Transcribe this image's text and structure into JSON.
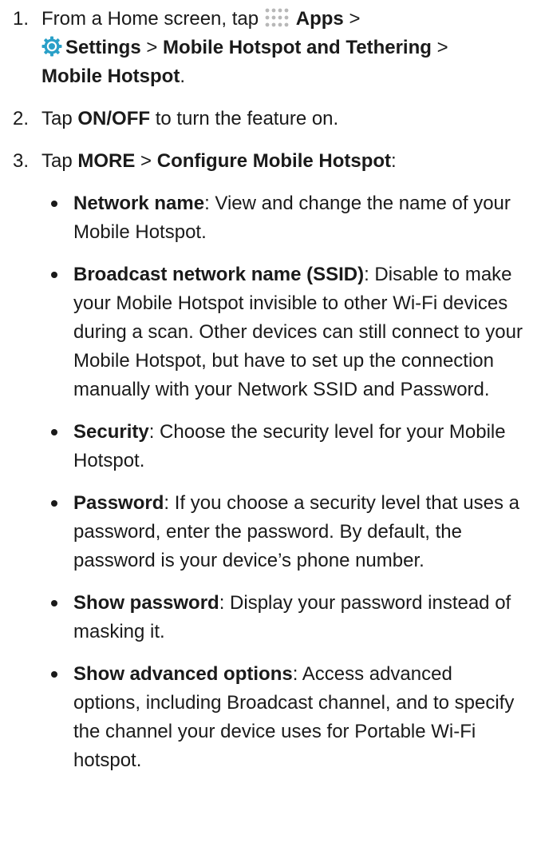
{
  "steps": [
    {
      "number": "1.",
      "parts": {
        "intro": "From a Home screen, tap",
        "apps": "Apps",
        "sep1": ">",
        "settings": "Settings",
        "sep2": ">",
        "hotspot_tethering": "Mobile Hotspot and Tethering",
        "sep3": ">",
        "mobile_hotspot": "Mobile Hotspot",
        "end": "."
      },
      "icons": [
        "apps-grid-icon",
        "settings-gear-icon"
      ]
    },
    {
      "number": "2.",
      "parts": {
        "intro": "Tap",
        "onoff": "ON/OFF",
        "rest": "to turn the feature on."
      }
    },
    {
      "number": "3.",
      "parts": {
        "intro": "Tap",
        "more": "MORE",
        "sep": ">",
        "configure": "Configure Mobile Hotspot",
        "end": ":"
      }
    }
  ],
  "options": [
    {
      "term": "Network name",
      "desc": ": View and change the name of your Mobile Hotspot."
    },
    {
      "term": "Broadcast network name (SSID)",
      "desc": ": Disable to make your Mobile Hotspot invisible to other Wi-Fi devices during a scan. Other devices can still connect to your Mobile Hotspot, but have to set up the connection manually with your Network SSID and Password."
    },
    {
      "term": "Security",
      "desc": ": Choose the security level for your Mobile Hotspot."
    },
    {
      "term": "Password",
      "desc": ": If you choose a security level that uses a password, enter the password. By default, the password is your device’s phone number."
    },
    {
      "term": "Show password",
      "desc": ": Display your password instead of masking it."
    },
    {
      "term": "Show advanced options",
      "desc": ": Access advanced options, including Broadcast channel, and to specify the channel your device uses for Portable Wi-Fi hotspot."
    }
  ],
  "colors": {
    "text": "#1a1a1a",
    "apps_icon": "#b8b8b8",
    "settings_icon": "#2aa0c8"
  }
}
